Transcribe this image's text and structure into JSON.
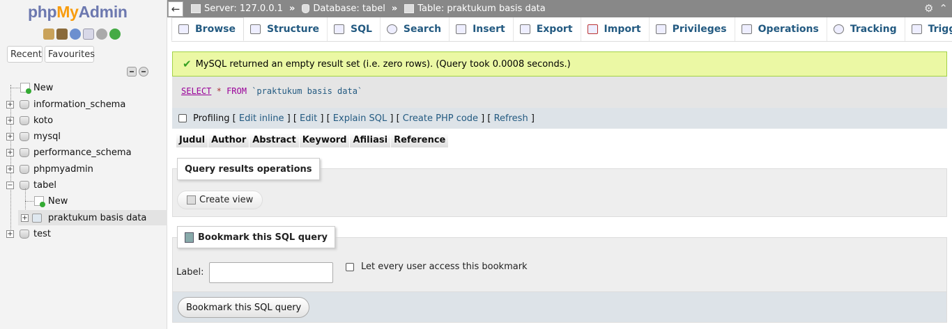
{
  "logo": {
    "php": "php",
    "my": "My",
    "admin": "Admin"
  },
  "nav": {
    "icons": [
      "home-icon",
      "logout-icon",
      "help-icon",
      "docs-icon",
      "settings-icon",
      "reload-icon"
    ],
    "recent_label": "Recent",
    "favourites_label": "Favourites",
    "tree": [
      {
        "label": "New"
      },
      {
        "label": "information_schema"
      },
      {
        "label": "koto"
      },
      {
        "label": "mysql"
      },
      {
        "label": "performance_schema"
      },
      {
        "label": "phpmyadmin"
      },
      {
        "label": "tabel"
      },
      {
        "label": "New"
      },
      {
        "label": "praktukum basis data"
      },
      {
        "label": "test"
      }
    ]
  },
  "breadcrumb": {
    "server": "Server: 127.0.0.1",
    "database": "Database: tabel",
    "table": "Table: praktukum basis data",
    "separator": "»"
  },
  "tabs": [
    {
      "label": "Browse",
      "icon": "browse-icon"
    },
    {
      "label": "Structure",
      "icon": "structure-icon"
    },
    {
      "label": "SQL",
      "icon": "sql-icon"
    },
    {
      "label": "Search",
      "icon": "search-icon"
    },
    {
      "label": "Insert",
      "icon": "insert-icon"
    },
    {
      "label": "Export",
      "icon": "export-icon"
    },
    {
      "label": "Import",
      "icon": "import-icon"
    },
    {
      "label": "Privileges",
      "icon": "privileges-icon"
    },
    {
      "label": "Operations",
      "icon": "operations-icon"
    },
    {
      "label": "Tracking",
      "icon": "tracking-icon"
    },
    {
      "label": "Triggers",
      "icon": "triggers-icon"
    }
  ],
  "message": {
    "text": "MySQL returned an empty result set (i.e. zero rows). (Query took 0.0008 seconds.)"
  },
  "sql": {
    "select": "SELECT",
    "star": "*",
    "from": "FROM",
    "table": "`praktukum basis data`"
  },
  "query_links": {
    "profiling": "Profiling",
    "edit_inline": "Edit inline",
    "edit": "Edit",
    "explain": "Explain SQL",
    "php_code": "Create PHP code",
    "refresh": "Refresh"
  },
  "columns": [
    "Judul",
    "Author",
    "Abstract",
    "Keyword",
    "Afiliasi",
    "Reference"
  ],
  "query_ops": {
    "legend": "Query results operations",
    "create_view": "Create view"
  },
  "bookmark": {
    "legend": "Bookmark this SQL query",
    "label": "Label:",
    "label_value": "",
    "every_user": "Let every user access this bookmark",
    "submit": "Bookmark this SQL query"
  },
  "colors": {
    "accent": "#235a81",
    "success_bg": "#ebf8a4",
    "topbar": "#888888",
    "logo_orange": "#f89c0e"
  }
}
